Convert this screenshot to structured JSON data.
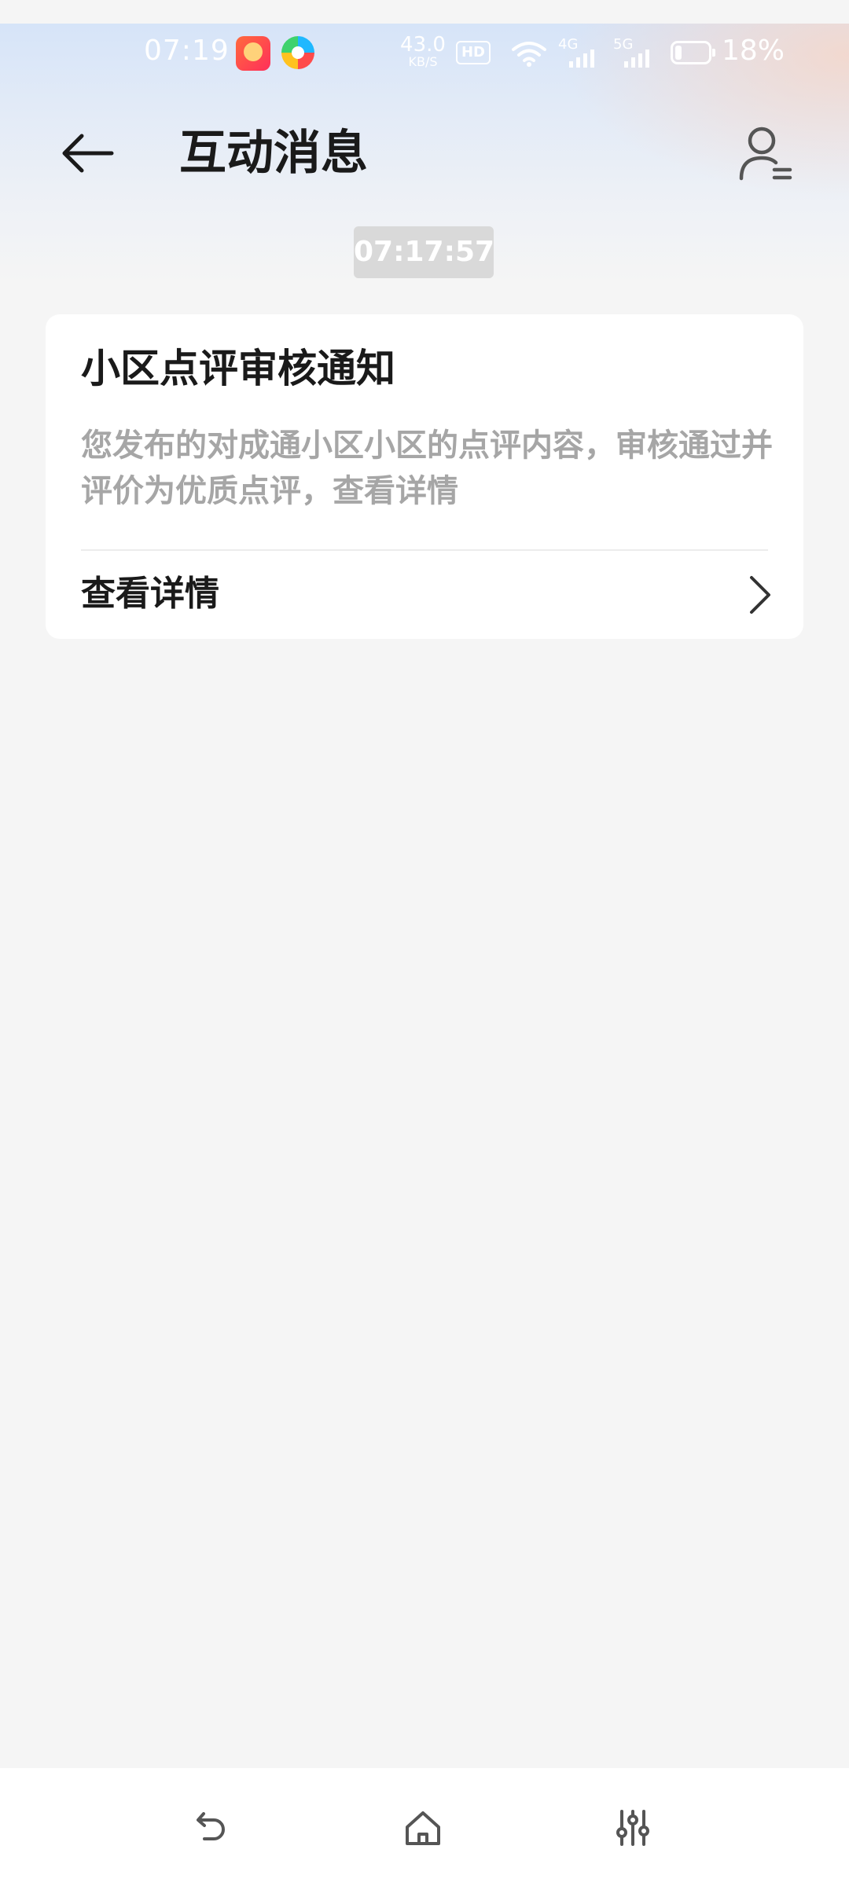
{
  "status_bar": {
    "time": "07:19",
    "net_speed_value": "43.0",
    "net_speed_unit": "KB/S",
    "hd_label": "HD",
    "signal_1_label": "4G",
    "signal_2_label": "5G",
    "battery_percent": "18%",
    "icons": [
      "app-notification-icon",
      "colorful-app-icon",
      "wifi-icon",
      "signal-4g-icon",
      "signal-5g-icon",
      "battery-icon"
    ]
  },
  "app_bar": {
    "title": "互动消息",
    "back_icon": "arrow-left-icon",
    "profile_icon": "person-list-icon"
  },
  "messages": [
    {
      "timestamp": "07:17:57",
      "title": "小区点评审核通知",
      "body": "您发布的对成通小区小区的点评内容，审核通过并评价为优质点评，查看详情",
      "action_label": "查看详情",
      "action_icon": "chevron-right-icon"
    }
  ],
  "nav_bar": {
    "icons": [
      "undo-back-icon",
      "home-icon",
      "sliders-icon"
    ]
  },
  "colors": {
    "background": "#f5f5f5",
    "card": "#ffffff",
    "title_text": "#1a1a1a",
    "secondary_text": "#a6a6a6",
    "timestamp_bg": "#d9d9d9"
  }
}
